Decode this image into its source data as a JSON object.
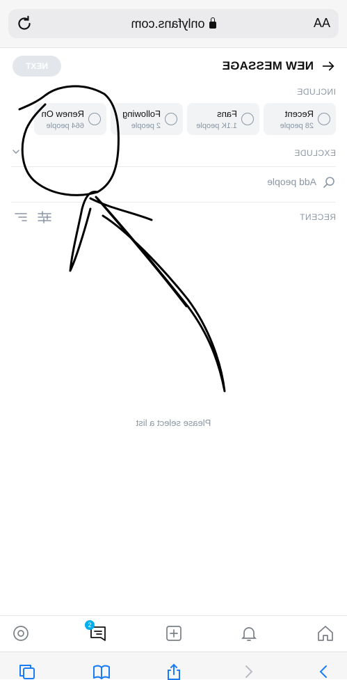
{
  "browser": {
    "text_size_label": "AA",
    "url": "onlyfans.com"
  },
  "header": {
    "title": "NEW MESSAGE",
    "next_label": "NEXT"
  },
  "include": {
    "label": "INCLUDE",
    "lists": [
      {
        "name": "Recent",
        "count": "28 people"
      },
      {
        "name": "Fans",
        "count": "1.1K people"
      },
      {
        "name": "Following",
        "count": "2 people"
      },
      {
        "name": "Renew On",
        "count": "664 people"
      }
    ]
  },
  "exclude": {
    "label": "EXCLUDE"
  },
  "search": {
    "placeholder": "Add people"
  },
  "recent": {
    "label": "RECENT",
    "empty_text": "Please select a list"
  },
  "tabbar": {
    "messages_badge": "2"
  },
  "colors": {
    "accent": "#00aff0",
    "muted": "#8a96a3",
    "chip_bg": "#f2f3f5"
  }
}
